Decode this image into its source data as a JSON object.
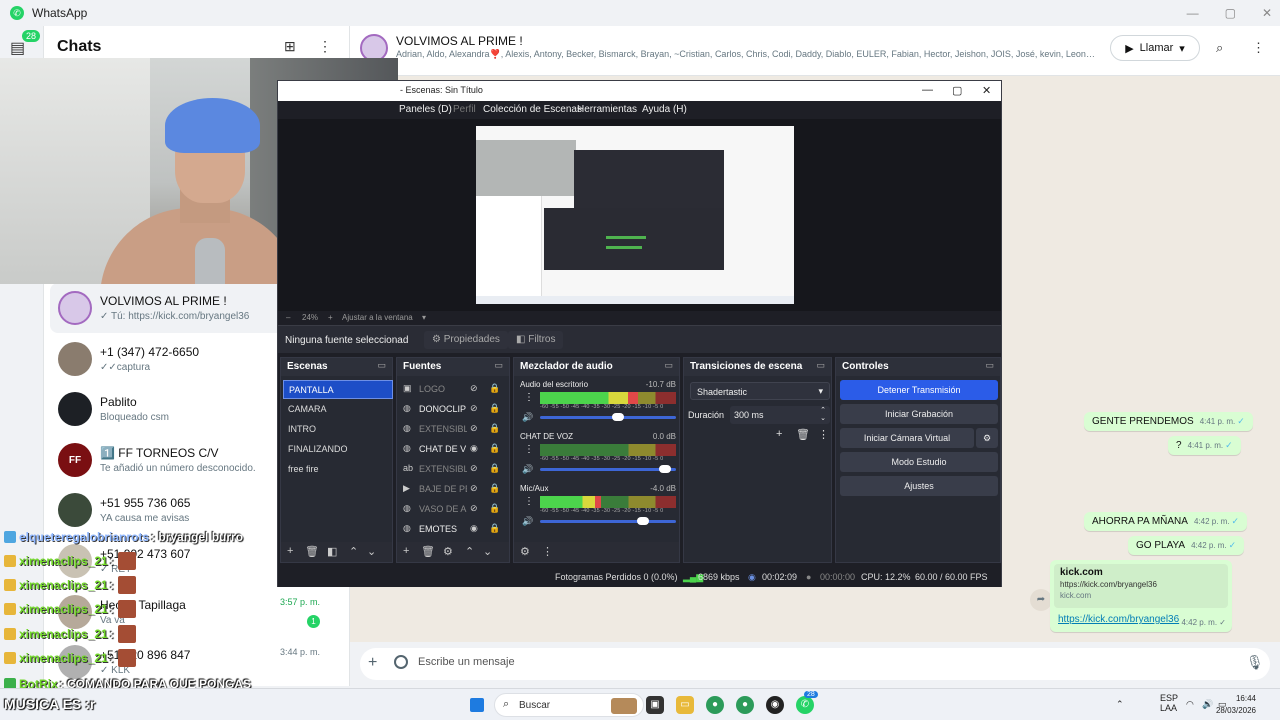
{
  "wa": {
    "app_title": "WhatsApp",
    "rail_badge": "28",
    "chats_title": "Chats",
    "chats": [
      {
        "name": "VOLVIMOS AL PRIME !",
        "sub": "✓ Tú: https://kick.com/bryangel36",
        "time": "",
        "unread": ""
      },
      {
        "name": "+1 (347) 472-6650",
        "sub": "✓✓captura",
        "time": "",
        "unread": ""
      },
      {
        "name": "Pablito",
        "sub": "Bloqueado csm",
        "time": "",
        "unread": ""
      },
      {
        "name": "1️⃣ FF TORNEOS C/V",
        "sub": "Te añadió un número desconocido.",
        "time": "",
        "unread": ""
      },
      {
        "name": "+51 955 736 065",
        "sub": "YA causa me avisas",
        "time": "",
        "unread": ""
      },
      {
        "name": "+51 902 473 607",
        "sub": "✓ REY",
        "time": "",
        "unread": ""
      },
      {
        "name": "Hector Tapillaga",
        "sub": "Va va",
        "time": "3:57 p. m.",
        "unread": "1"
      },
      {
        "name": "+51 920 896 847",
        "sub": "✓ KLK",
        "time": "3:44 p. m.",
        "unread": ""
      }
    ],
    "ff_avatar_text": "FF",
    "header": {
      "group_name": "VOLVIMOS AL PRIME !",
      "members": "Adrian, Aldo, Alexandra❣️, Alexis, Antony, Becker, Bismarck, Brayan, ~Cristian, Carlos, Chris, Codi, Daddy, Diablo, EULER, Fabian, Hector, Jeishon, JOIS, José, kevin, Leonardo, Leyth...",
      "call_label": "Llamar"
    },
    "messages": [
      {
        "text": "GENTE PRENDEMOS",
        "time": "4:41 p. m."
      },
      {
        "text": "?",
        "time": "4:41 p. m."
      },
      {
        "text": "AHORRA PA MÑANA",
        "time": "4:42 p. m."
      },
      {
        "text": "GO PLAYA",
        "time": "4:42 p. m."
      }
    ],
    "link_card": {
      "title": "kick.com",
      "url": "https://kick.com/bryangel36",
      "domain": "kick.com",
      "link": "https://kick.com/bryangel36",
      "time": "4:42 p. m."
    },
    "composer_placeholder": "Escribe un mensaje"
  },
  "obs": {
    "title": "- Escenas: Sin Título",
    "menu": [
      "Paneles (D)",
      "Perfil",
      "Colección de Escenas",
      "Herramientas",
      "Ayuda (H)"
    ],
    "zoom": "24%",
    "zoom_fit": "Ajustar a la ventana",
    "no_source": "Ninguna fuente seleccionad",
    "properties": "Propiedades",
    "filters": "Filtros",
    "scenes_title": "Escenas",
    "scenes": [
      "PANTALLA",
      "CAMARA",
      "INTRO",
      "FINALIZANDO",
      "free fire"
    ],
    "sources_title": "Fuentes",
    "sources": [
      {
        "name": "LOGO",
        "icon": "image-icon",
        "visible": false
      },
      {
        "name": "DONOCLIP",
        "icon": "browser-icon",
        "visible": false
      },
      {
        "name": "EXTENSIBL",
        "icon": "browser-icon",
        "visible": false
      },
      {
        "name": "CHAT DE V",
        "icon": "browser-icon",
        "visible": true
      },
      {
        "name": "EXTENSIBL",
        "icon": "text-icon",
        "visible": false
      },
      {
        "name": "BAJE DE PE",
        "icon": "media-icon",
        "visible": false
      },
      {
        "name": "VASO DE A",
        "icon": "browser-icon",
        "visible": false
      },
      {
        "name": "EMOTES",
        "icon": "browser-icon",
        "visible": true
      }
    ],
    "mixer_title": "Mezclador de audio",
    "mixer": [
      {
        "name": "Audio del escritorio",
        "db": "-10.7 dB",
        "level": 0.72,
        "volume": 0.62
      },
      {
        "name": "CHAT DE VOZ",
        "db": "0.0 dB",
        "level": 0.0,
        "volume": 0.96
      },
      {
        "name": "Mic/Aux",
        "db": "-4.0 dB",
        "level": 0.45,
        "volume": 0.8
      }
    ],
    "meter_scale": "-60 -55 -50 -45 -40 -35 -30 -25 -20 -15 -10 -5 0",
    "transitions_title": "Transiciones de escena",
    "transition": "Shadertastic",
    "duration_label": "Duración",
    "duration": "300 ms",
    "controls_title": "Controles",
    "controls": [
      "Detener Transmisión",
      "Iniciar Grabación",
      "Iniciar Cámara Virtual",
      "Modo Estudio",
      "Ajustes"
    ],
    "status": {
      "dropped": "Fotogramas Perdidos 0 (0.0%)",
      "bitrate": "6869 kbps",
      "live_time": "00:02:09",
      "rec_time": "00:00:00",
      "cpu": "CPU: 12.2%",
      "fps": "60.00 / 60.00 FPS"
    }
  },
  "stream_chat": [
    {
      "user": "elqueteregalobrianrots",
      "text": ": bryangel burro",
      "color": "blue"
    },
    {
      "user": "ximenaclips_21",
      "text": ":",
      "color": "green"
    },
    {
      "user": "ximenaclips_21",
      "text": ":",
      "color": "green"
    },
    {
      "user": "ximenaclips_21",
      "text": ":",
      "color": "green"
    },
    {
      "user": "ximenaclips_21",
      "text": ":",
      "color": "green"
    },
    {
      "user": "ximenaclips_21",
      "text": ":",
      "color": "green"
    },
    {
      "user": "BotRix",
      "text": ": COMANDO PARA QUE PONGAS",
      "color": "green"
    }
  ],
  "overlay_text": "MUSICA ES :r",
  "taskbar": {
    "search": "Buscar",
    "whatsapp_badge": "28",
    "lang": "ESP",
    "region": "LAA",
    "time": "16:44",
    "date": "28/03/2026"
  }
}
